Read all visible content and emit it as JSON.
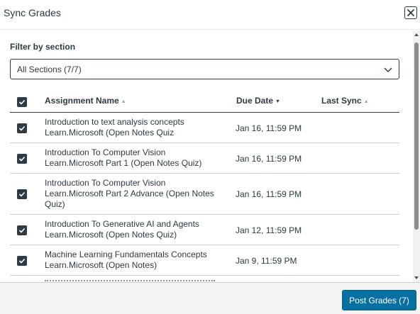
{
  "dialog": {
    "title": "Sync Grades"
  },
  "filter": {
    "label": "Filter by section",
    "selected": "All Sections (7/7)"
  },
  "table": {
    "headers": {
      "name": "Assignment Name",
      "due": "Due Date",
      "sync": "Last Sync"
    },
    "sort": {
      "column": "due",
      "direction": "descending"
    },
    "select_all_checked": true,
    "rows": [
      {
        "checked": true,
        "name_line1": "Introduction to text analysis concepts",
        "name_line2": "Learn.Microsoft (Open Notes Quiz",
        "name_line3": "",
        "due": "Jan 16, 11:59 PM",
        "last_sync": ""
      },
      {
        "checked": true,
        "name_line1": "Introduction To Computer Vision",
        "name_line2": "Learn.Microsoft Part 1 (Open Notes Quiz)",
        "name_line3": "",
        "due": "Jan 16, 11:59 PM",
        "last_sync": ""
      },
      {
        "checked": true,
        "name_line1": "Introduction To Computer Vision",
        "name_line2": "Learn.Microsoft Part 2 Advance (Open Notes",
        "name_line3": "Quiz)",
        "due": "Jan 16, 11:59 PM",
        "last_sync": ""
      },
      {
        "checked": true,
        "name_line1": "Introduction To Generative AI and Agents",
        "name_line2": "Learn.Microsoft (Open Notes Quiz)",
        "name_line3": "",
        "due": "Jan 12, 11:59 PM",
        "last_sync": ""
      },
      {
        "checked": true,
        "name_line1": "Machine Learning Fundamentals Concepts",
        "name_line2": "Learn.Microsoft (Open Notes)",
        "name_line3": "",
        "due": "Jan 9, 11:59 PM",
        "last_sync": ""
      }
    ]
  },
  "footer": {
    "post_label": "Post Grades (7)"
  },
  "colors": {
    "primary": "#0770a3",
    "text": "#2d3b45",
    "checkbox": "#2d3b45",
    "border": "#c7cdd1"
  }
}
